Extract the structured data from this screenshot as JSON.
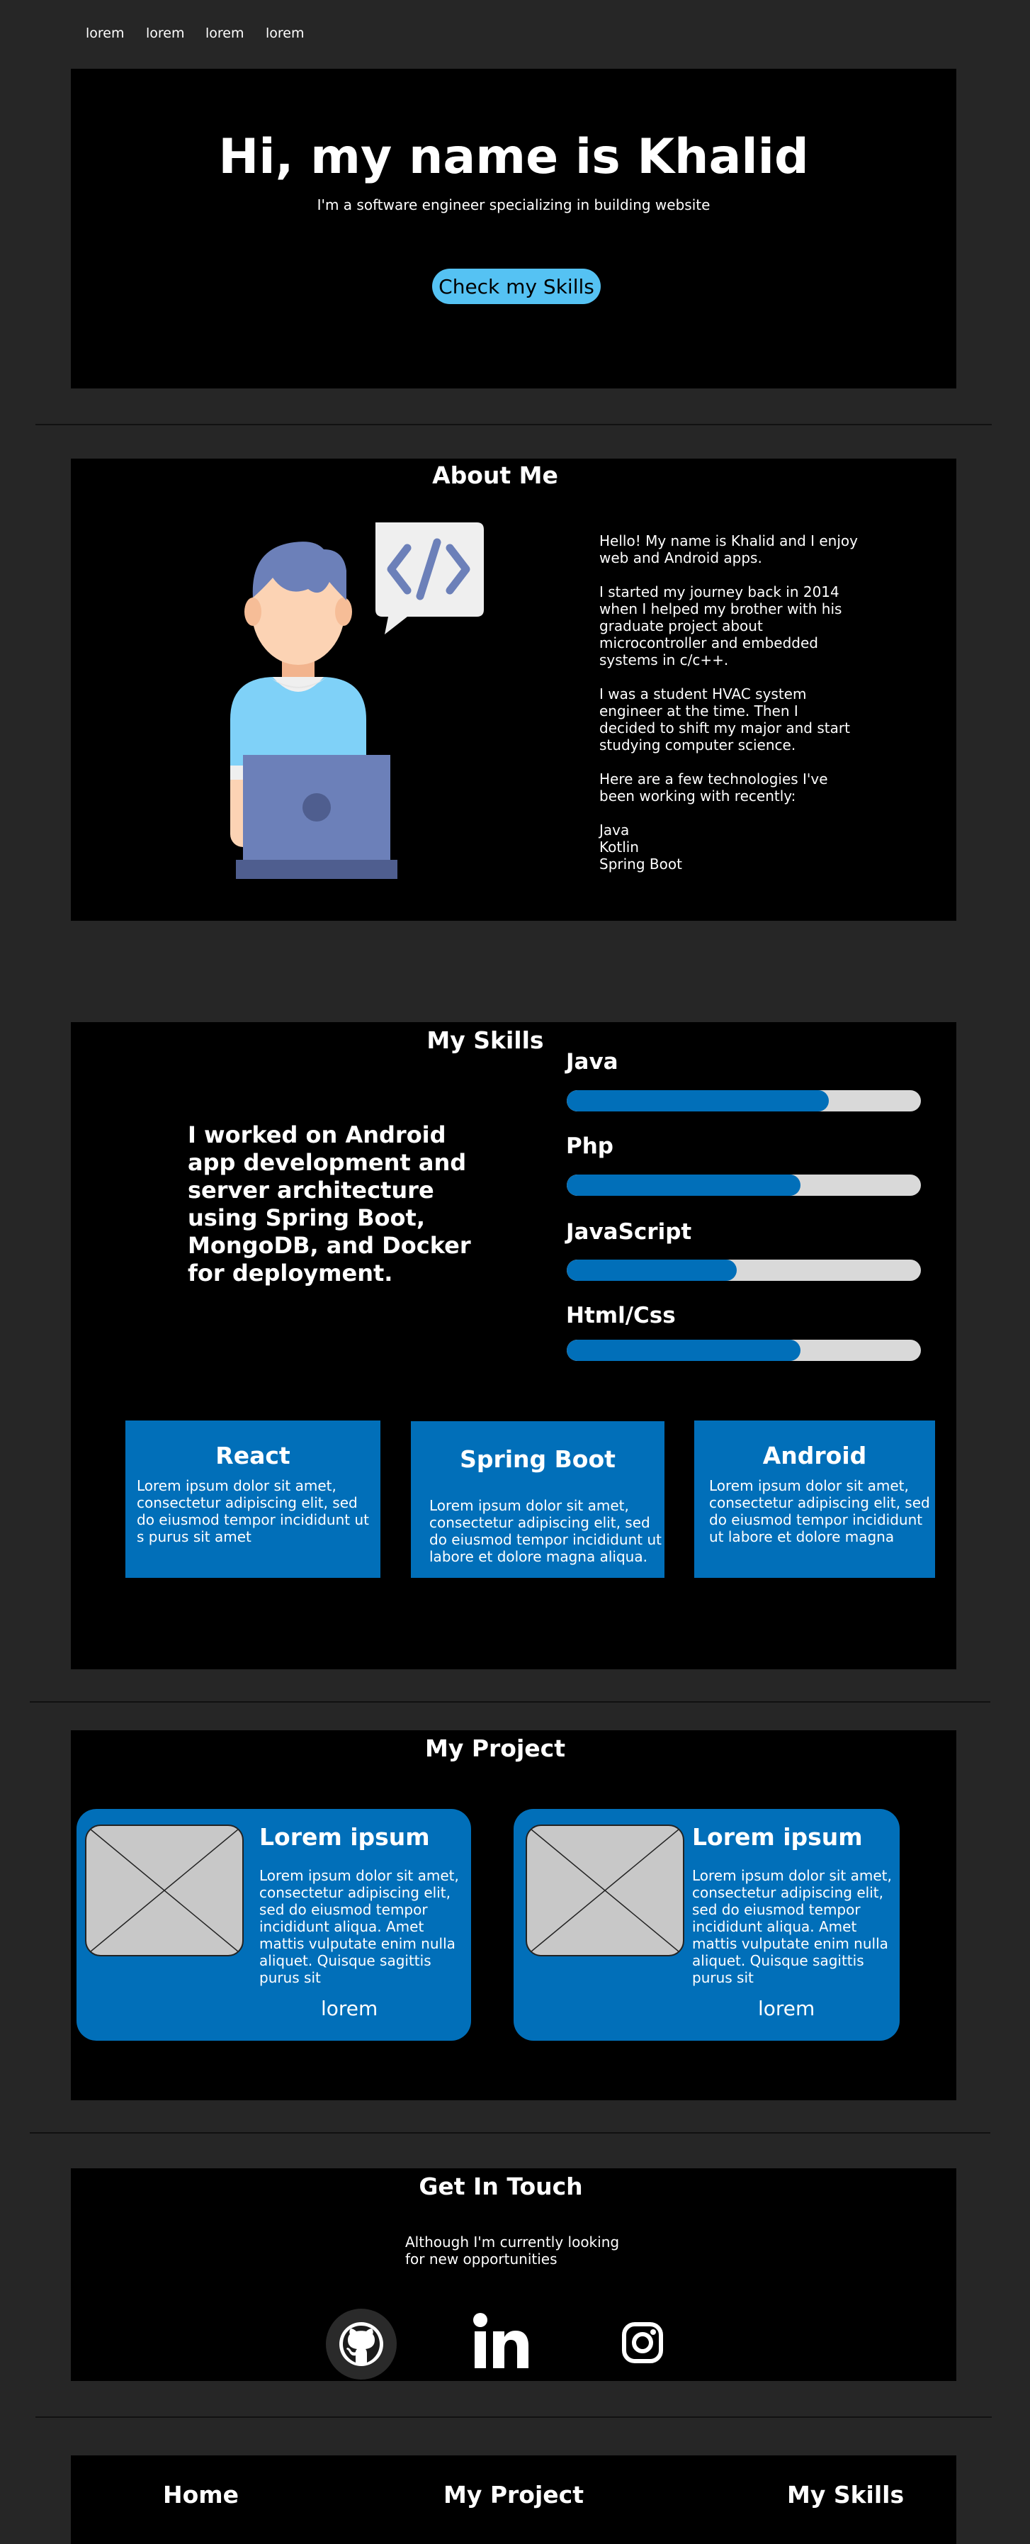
{
  "nav": {
    "items": [
      "lorem",
      "lorem",
      "lorem",
      "lorem"
    ]
  },
  "hero": {
    "title": "Hi, my name is Khalid",
    "subtitle": "I'm a software engineer specializing in building website",
    "button": "Check my Skills"
  },
  "about": {
    "title": "About Me",
    "paragraphs": [
      "Hello! My name is Khalid and I enjoy web and Android apps.",
      "I started my journey back in 2014 when I helped my brother with his graduate project about microcontroller and embedded systems in c/c++.",
      "I was a student HVAC system engineer at the time. Then I decided to shift my major and start studying computer science.",
      "Here are a few technologies I've been working with recently:"
    ],
    "technologies": [
      "Java",
      "Kotlin",
      "Spring Boot"
    ]
  },
  "skills": {
    "title": "My Skills",
    "intro": "I worked on Android app development and server architecture using Spring Boot, MongoDB, and Docker for deployment.",
    "bars": [
      {
        "name": "Java",
        "level": 0.74
      },
      {
        "name": "Php",
        "level": 0.66
      },
      {
        "name": "JavaScript",
        "level": 0.48
      },
      {
        "name": "Html/Css",
        "level": 0.66
      }
    ],
    "cards": [
      {
        "title": "React",
        "text": "Lorem ipsum dolor sit amet, consectetur adipiscing elit, sed do eiusmod tempor incididunt ut s purus sit amet"
      },
      {
        "title": "Spring Boot",
        "text": "Lorem ipsum dolor sit amet, consectetur adipiscing elit, sed do eiusmod tempor incididunt ut labore et dolore magna aliqua."
      },
      {
        "title": "Android",
        "text": "Lorem ipsum dolor sit amet, consectetur adipiscing elit, sed do eiusmod tempor incididunt ut labore et dolore magna"
      }
    ]
  },
  "projects": {
    "title": "My Project",
    "items": [
      {
        "title": "Lorem ipsum",
        "text": "Lorem ipsum dolor sit amet, consectetur adipiscing elit, sed do eiusmod tempor incididunt aliqua. Amet mattis vulputate enim nulla aliquet. Quisque sagittis purus sit",
        "link": "lorem"
      },
      {
        "title": "Lorem ipsum",
        "text": "Lorem ipsum dolor sit amet, consectetur adipiscing elit, sed do eiusmod tempor incididunt aliqua. Amet mattis vulputate enim nulla aliquet. Quisque sagittis purus sit",
        "link": "lorem"
      }
    ]
  },
  "contact": {
    "title": "Get In Touch",
    "text": "Although I'm currently looking for new opportunities",
    "icons": [
      "github-icon",
      "linkedin-icon",
      "instagram-icon"
    ]
  },
  "footer": {
    "links": [
      "Home",
      "My Project",
      "My Skills"
    ]
  },
  "colors": {
    "accent": "#016fb9",
    "button": "#55c2f3",
    "background": "#262626",
    "panel": "#000000"
  }
}
